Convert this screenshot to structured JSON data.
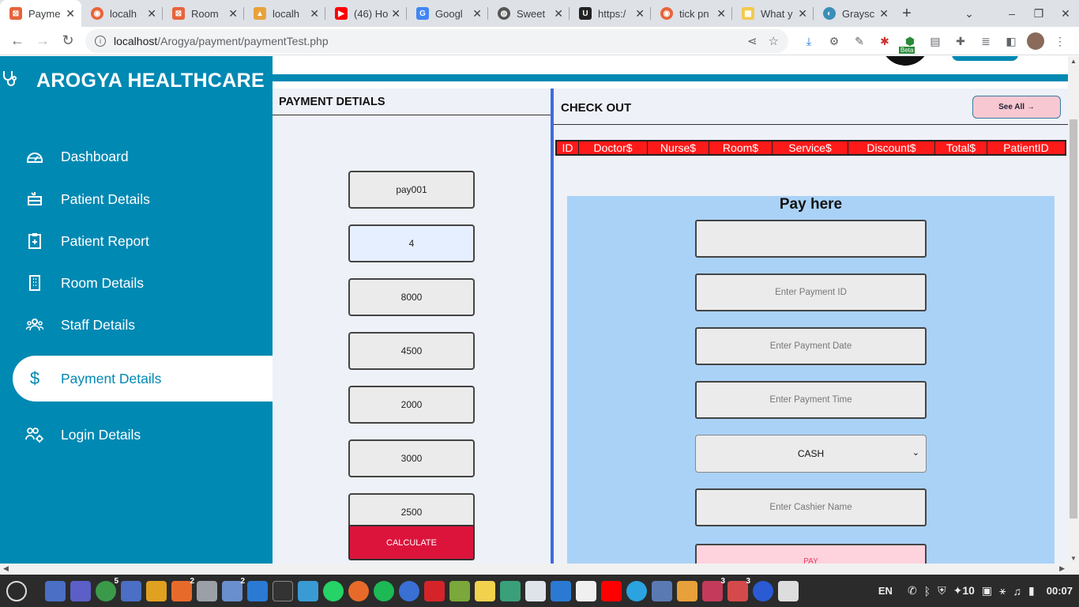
{
  "browser": {
    "tabs": [
      {
        "label": "Payme",
        "color": "#e8643a",
        "active": true
      },
      {
        "label": "localh",
        "color": "#e8643a"
      },
      {
        "label": "Room",
        "color": "#e8643a"
      },
      {
        "label": "localh",
        "color": "#e8a23a"
      },
      {
        "label": "(46) Ho",
        "color": "#ff0000"
      },
      {
        "label": "Googl",
        "color": "#4285f4"
      },
      {
        "label": "Sweet",
        "color": "#555555"
      },
      {
        "label": "https:/",
        "color": "#222222"
      },
      {
        "label": "tick pn",
        "color": "#e8643a"
      },
      {
        "label": "What y",
        "color": "#f2c94c"
      },
      {
        "label": "Graysc",
        "color": "#3a8fb7"
      }
    ],
    "url_host": "localhost",
    "url_path": "/Arogya/payment/paymentTest.php",
    "ext_badge": "Beta"
  },
  "sidebar": {
    "brand": "AROGYA HEALTHCARE",
    "items": [
      {
        "label": "Dashboard",
        "icon": "dashboard-icon"
      },
      {
        "label": "Patient Details",
        "icon": "patient-bed-icon"
      },
      {
        "label": "Patient Report",
        "icon": "clipboard-icon"
      },
      {
        "label": "Room Details",
        "icon": "building-icon"
      },
      {
        "label": "Staff Details",
        "icon": "users-icon"
      },
      {
        "label": "Payment Details",
        "icon": "dollar-icon",
        "active": true
      },
      {
        "label": "Login Details",
        "icon": "user-gear-icon"
      }
    ]
  },
  "payment_panel": {
    "title": "PAYMENT DETIALS",
    "fields": [
      "pay001",
      "4",
      "8000",
      "4500",
      "2000",
      "3000",
      "2500"
    ],
    "calculate_label": "CALCULATE"
  },
  "checkout": {
    "title": "CHECK OUT",
    "see_all_label": "See All →",
    "columns": [
      "ID",
      "Doctor$",
      "Nurse$",
      "Room$",
      "Service$",
      "Discount$",
      "Total$",
      "PatientID"
    ]
  },
  "pay_form": {
    "title": "Pay here",
    "amount_value": "",
    "payment_id_placeholder": "Enter Payment ID",
    "payment_date_placeholder": "Enter Payment Date",
    "payment_time_placeholder": "Enter Payment Time",
    "method_selected": "CASH",
    "cashier_placeholder": "Enter Cashier Name",
    "pay_label": "PAY"
  },
  "taskbar": {
    "badges": [
      "5",
      "2",
      "2",
      "3",
      "3"
    ],
    "language": "EN",
    "notification_count": "10",
    "clock": "00:07"
  },
  "colors": {
    "sidebar": "#0089b3",
    "header_row": "#ff1a1a",
    "calc_button": "#dc143c",
    "pay_bg": "#aad2f7"
  }
}
